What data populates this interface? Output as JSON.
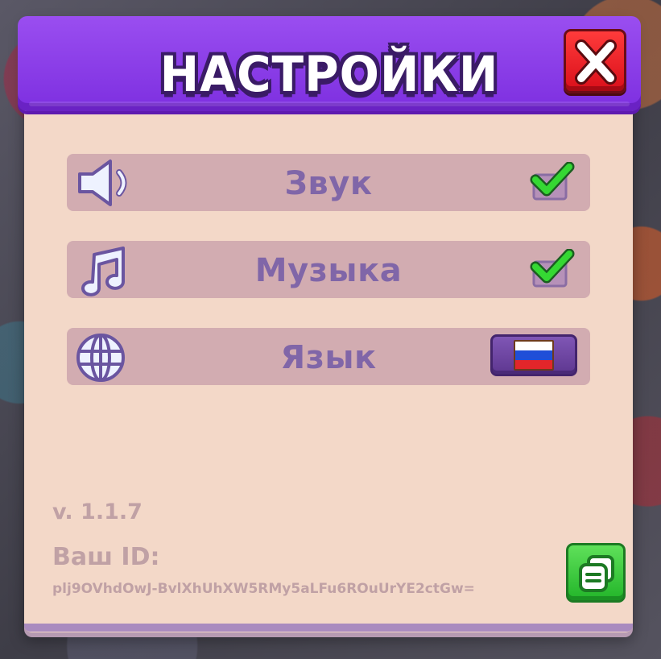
{
  "dialog": {
    "title": "НАСТРОЙКИ",
    "close_icon": "close-x-icon"
  },
  "settings": [
    {
      "label": "Звук",
      "icon": "speaker-icon",
      "control": "checkbox",
      "checked": true
    },
    {
      "label": "Музыка",
      "icon": "music-note-icon",
      "control": "checkbox",
      "checked": true
    },
    {
      "label": "Язык",
      "icon": "globe-icon",
      "control": "language-button",
      "value_icon": "russian-flag-icon"
    }
  ],
  "footer": {
    "version": "v. 1.1.7",
    "id_label": "Ваш ID:",
    "id_value": "plj9OVhdOwJ-BvlXhUhXW5RMy5aLFu6ROuUrYE2ctGw=",
    "copy_icon": "copy-icon"
  },
  "colors": {
    "header": "#8a3ce8",
    "panel": "#f3d8c8",
    "row": "#d2acb1",
    "label": "#8066a8",
    "close": "#e81b25",
    "copy": "#37c93a",
    "check": "#2fd52f"
  }
}
